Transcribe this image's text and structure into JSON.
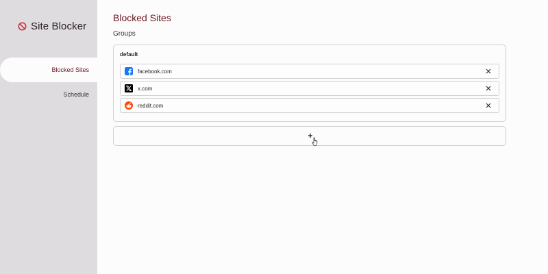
{
  "app": {
    "title": "Site Blocker",
    "brand_icon": "block-icon",
    "accent_color": "#6b1620"
  },
  "sidebar": {
    "items": [
      {
        "label": "Blocked Sites",
        "active": true
      },
      {
        "label": "Schedule",
        "active": false
      }
    ]
  },
  "main": {
    "title": "Blocked Sites",
    "groups_heading": "Groups",
    "groups": [
      {
        "name": "default",
        "sites": [
          {
            "label": "facebook.com",
            "icon": "facebook-icon",
            "remove_icon": "close-icon"
          },
          {
            "label": "x.com",
            "icon": "x-icon",
            "remove_icon": "close-icon"
          },
          {
            "label": "reddit.com",
            "icon": "reddit-icon",
            "remove_icon": "close-icon"
          }
        ]
      }
    ],
    "add_group_icon": "plus-icon"
  }
}
